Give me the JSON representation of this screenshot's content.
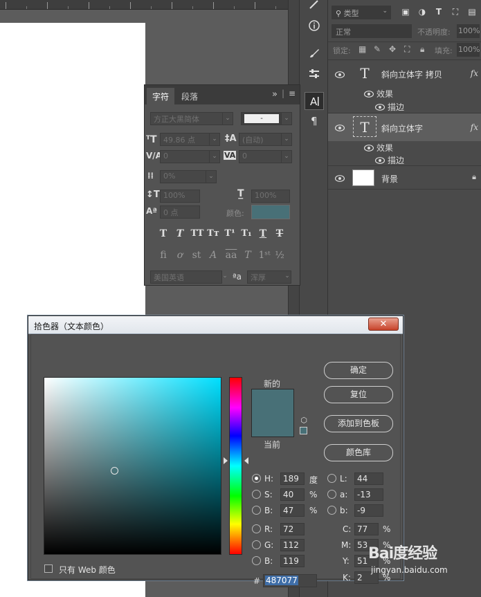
{
  "layers_panel": {
    "filter_kind": "类型",
    "blend_mode": "正常",
    "opacity_label": "不透明度:",
    "opacity_value": "100%",
    "lock_label": "锁定:",
    "fill_label": "填充:",
    "fill_value": "100%",
    "layers": [
      {
        "name": "斜向立体字 拷贝",
        "fx": "fx",
        "effects_label": "效果",
        "stroke_label": "描边"
      },
      {
        "name": "斜向立体字",
        "fx": "fx",
        "effects_label": "效果",
        "stroke_label": "描边"
      },
      {
        "name": "背景"
      }
    ]
  },
  "char_panel": {
    "tab_character": "字符",
    "tab_paragraph": "段落",
    "menu_glyph": "»",
    "font_family": "方正大黑简体",
    "font_style": "-",
    "font_size": "49.86 点",
    "leading": "(自动)",
    "kerning": "0",
    "tracking": "0",
    "tsume": "0%",
    "vertical_scale": "100%",
    "horizontal_scale": "100%",
    "baseline_shift": "0 点",
    "color_label": "颜色:",
    "language": "美国英语",
    "aa_glyph": "ªa",
    "anti_alias": "浑厚"
  },
  "picker": {
    "title": "拾色器（文本颜色）",
    "close_glyph": "✕",
    "new_label": "新的",
    "current_label": "当前",
    "ok_label": "确定",
    "reset_label": "复位",
    "add_swatch_label": "添加到色板",
    "libraries_label": "颜色库",
    "web_only_label": "只有 Web 颜色",
    "hex_hash": "#",
    "hex_value": "487077",
    "hsb": [
      {
        "label": "H:",
        "value": "189",
        "unit": "度"
      },
      {
        "label": "S:",
        "value": "40",
        "unit": "%"
      },
      {
        "label": "B:",
        "value": "47",
        "unit": "%"
      }
    ],
    "rgb": [
      {
        "label": "R:",
        "value": "72"
      },
      {
        "label": "G:",
        "value": "112"
      },
      {
        "label": "B:",
        "value": "119"
      }
    ],
    "lab": [
      {
        "label": "L:",
        "value": "44"
      },
      {
        "label": "a:",
        "value": "-13"
      },
      {
        "label": "b:",
        "value": "-9"
      }
    ],
    "cmyk": [
      {
        "label": "C:",
        "value": "77",
        "unit": "%"
      },
      {
        "label": "M:",
        "value": "53",
        "unit": "%"
      },
      {
        "label": "Y:",
        "value": "51",
        "unit": "%"
      },
      {
        "label": "K:",
        "value": "2",
        "unit": "%"
      }
    ]
  },
  "watermark": {
    "logo": "Bai度经验",
    "url": "jingyan.baidu.com"
  },
  "colors": {
    "text_color": "#487077",
    "hue_field_color": "#00dfff",
    "selection_blue": "#3f6ea8"
  }
}
